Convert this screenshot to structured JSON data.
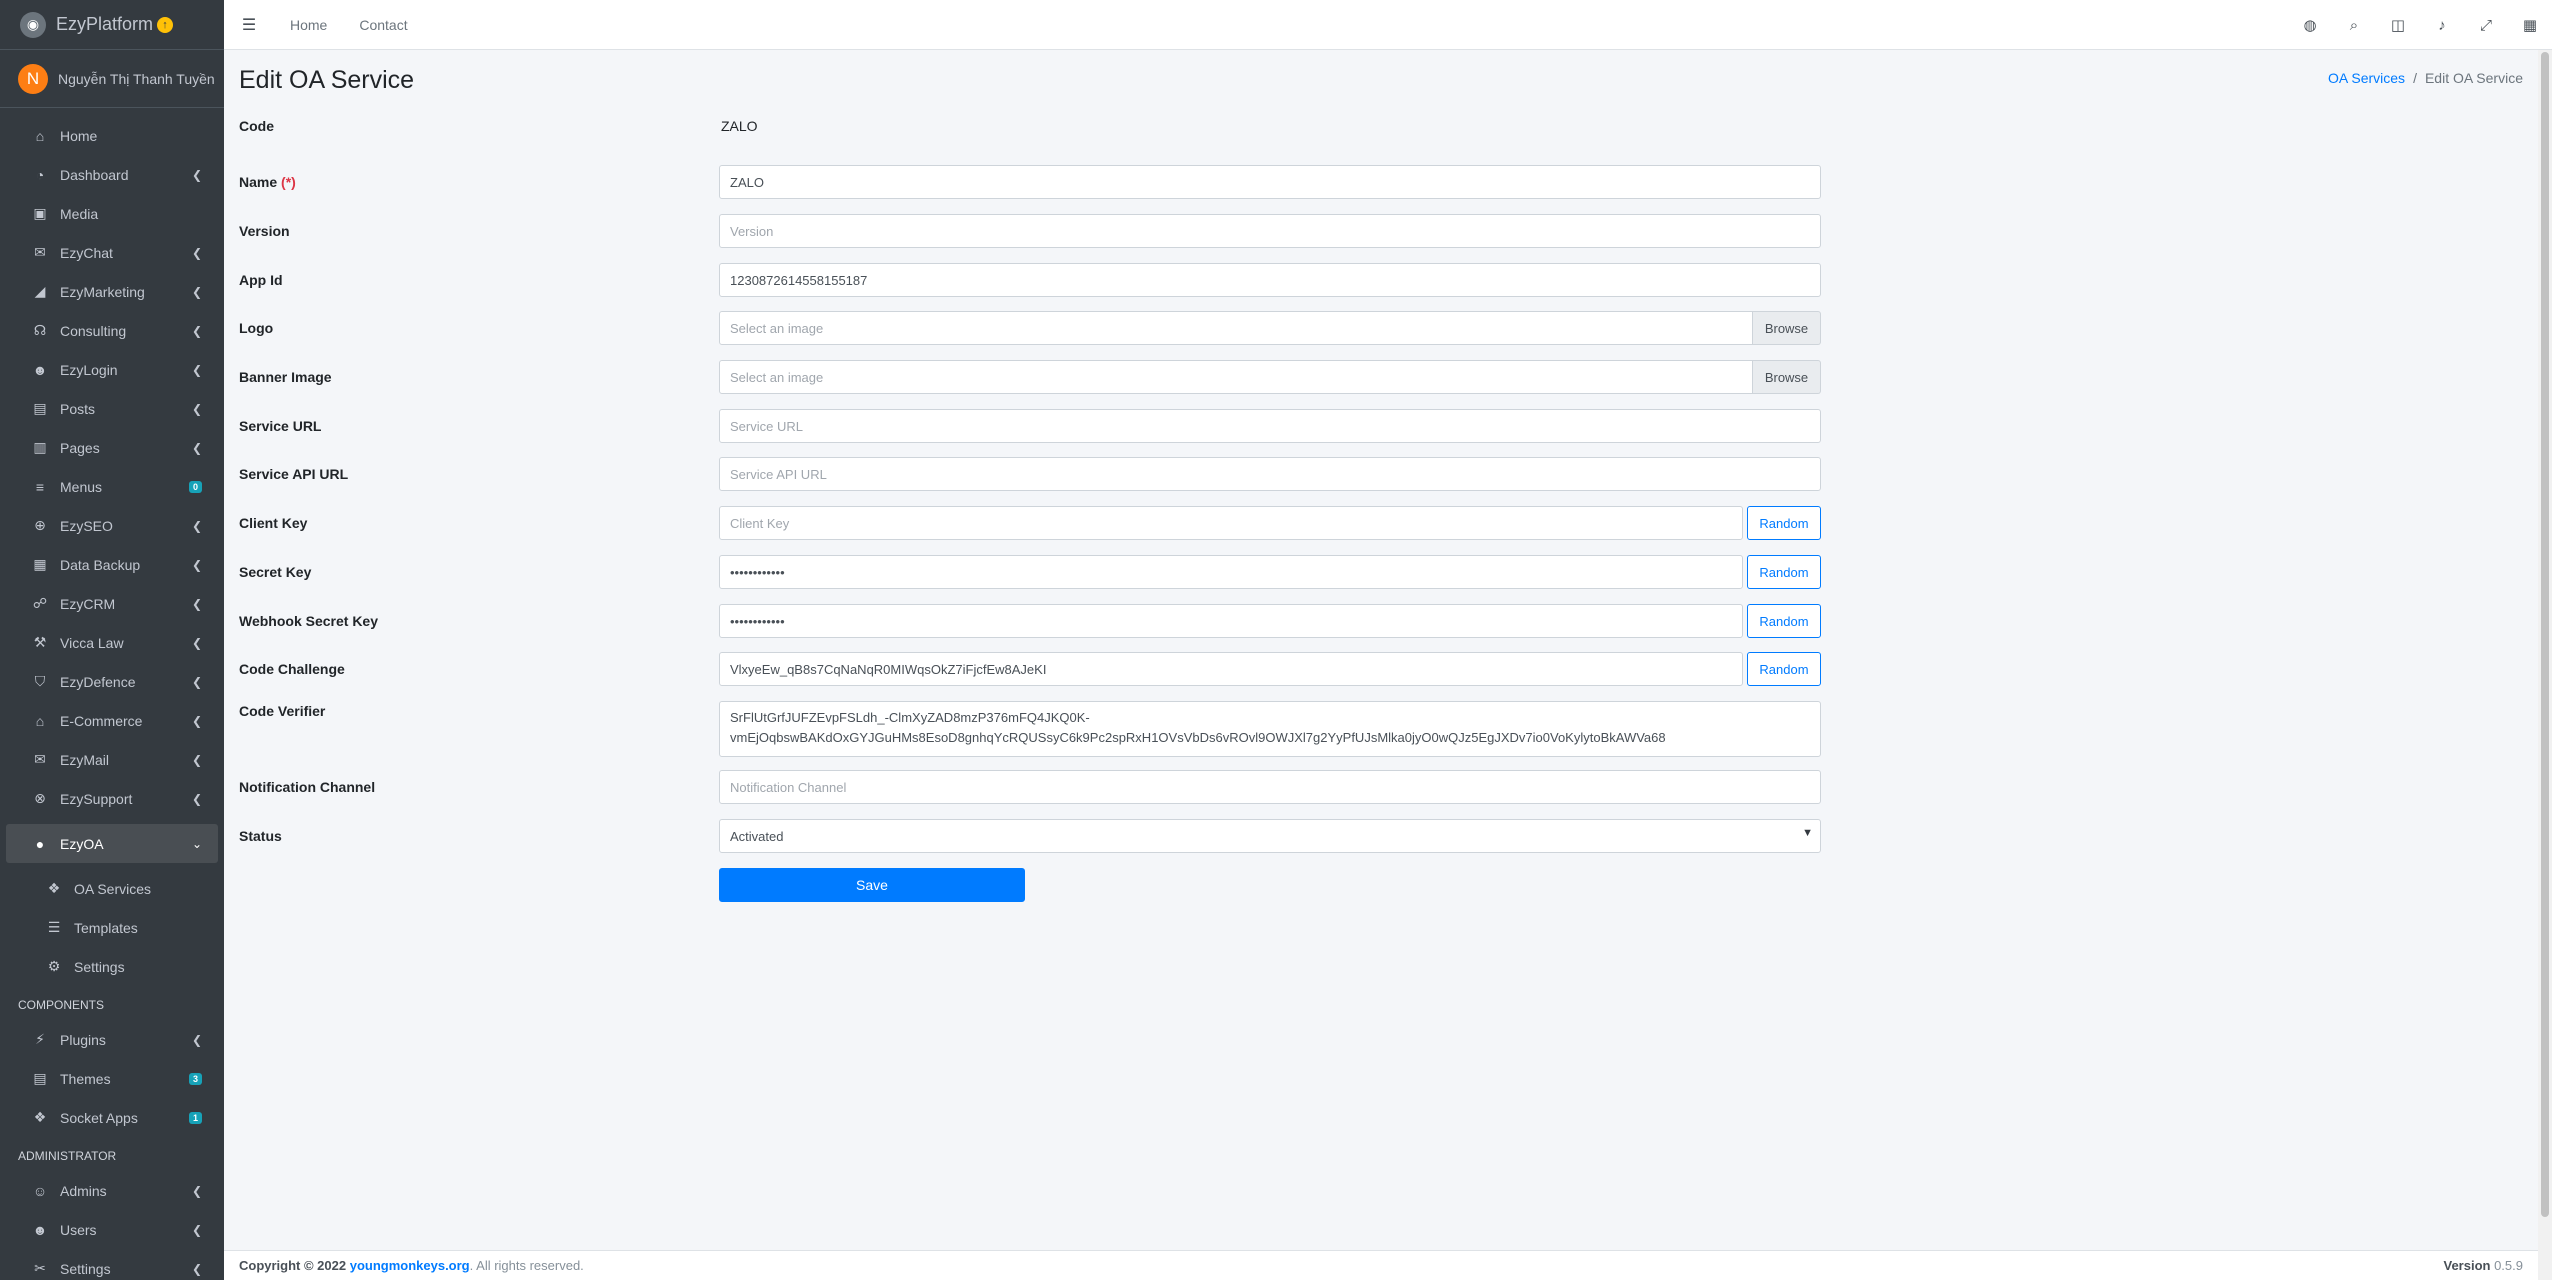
{
  "brand": {
    "name": "EzyPlatform",
    "badge": "↑"
  },
  "user": {
    "initial": "N",
    "name": "Nguyễn Thị Thanh Tuyền"
  },
  "sidebar": {
    "items": [
      {
        "label": "Home",
        "icon": "home-icon"
      },
      {
        "label": "Dashboard",
        "icon": "dashboard-icon",
        "arrow": "‹"
      },
      {
        "label": "Media",
        "icon": "image-icon"
      },
      {
        "label": "EzyChat",
        "icon": "chat-icon",
        "arrow": "‹"
      },
      {
        "label": "EzyMarketing",
        "icon": "megaphone-icon",
        "arrow": "‹"
      },
      {
        "label": "Consulting",
        "icon": "headset-icon",
        "arrow": "‹"
      },
      {
        "label": "EzyLogin",
        "icon": "user-lock-icon",
        "arrow": "‹"
      },
      {
        "label": "Posts",
        "icon": "posts-icon",
        "arrow": "‹"
      },
      {
        "label": "Pages",
        "icon": "pages-icon",
        "arrow": "‹"
      },
      {
        "label": "Menus",
        "icon": "menu-icon",
        "badge": "0"
      },
      {
        "label": "EzySEO",
        "icon": "search-plus-icon",
        "arrow": "‹"
      },
      {
        "label": "Data Backup",
        "icon": "database-icon",
        "arrow": "‹"
      },
      {
        "label": "EzyCRM",
        "icon": "handshake-icon",
        "arrow": "‹"
      },
      {
        "label": "Vicca Law",
        "icon": "gavel-icon",
        "arrow": "‹"
      },
      {
        "label": "EzyDefence",
        "icon": "shield-icon",
        "arrow": "‹"
      },
      {
        "label": "E-Commerce",
        "icon": "store-icon",
        "arrow": "‹"
      },
      {
        "label": "EzyMail",
        "icon": "mail-icon",
        "arrow": "‹"
      },
      {
        "label": "EzySupport",
        "icon": "support-icon",
        "arrow": "‹"
      },
      {
        "label": "EzyOA",
        "icon": "circle-icon",
        "arrow": "⌄"
      }
    ],
    "sub_items": [
      {
        "label": "OA Services",
        "icon": "cubes-icon"
      },
      {
        "label": "Templates",
        "icon": "list-icon"
      },
      {
        "label": "Settings",
        "icon": "cogs-icon"
      }
    ],
    "components_header": "COMPONENTS",
    "components": [
      {
        "label": "Plugins",
        "icon": "plug-icon",
        "arrow": "‹"
      },
      {
        "label": "Themes",
        "icon": "themes-icon",
        "badge": "3"
      },
      {
        "label": "Socket Apps",
        "icon": "socket-icon",
        "badge": "1"
      }
    ],
    "admin_header": "ADMINISTRATOR",
    "admin": [
      {
        "label": "Admins",
        "icon": "user-circle-icon",
        "arrow": "‹"
      },
      {
        "label": "Users",
        "icon": "users-icon",
        "arrow": "‹"
      },
      {
        "label": "Settings",
        "icon": "tools-icon",
        "arrow": "‹"
      }
    ]
  },
  "topbar": {
    "menu_icon": "☰",
    "links": [
      "Home",
      "Contact"
    ]
  },
  "page": {
    "title": "Edit OA Service",
    "breadcrumb": {
      "parent": "OA Services",
      "current": "Edit OA Service"
    }
  },
  "form": {
    "code": {
      "label": "Code",
      "value": "ZALO"
    },
    "name": {
      "label": "Name",
      "required": "(*)",
      "value": "ZALO"
    },
    "version": {
      "label": "Version",
      "placeholder": "Version"
    },
    "app_id": {
      "label": "App Id",
      "value": "1230872614558155187"
    },
    "logo": {
      "label": "Logo",
      "placeholder": "Select an image",
      "button": "Browse"
    },
    "banner": {
      "label": "Banner Image",
      "placeholder": "Select an image",
      "button": "Browse"
    },
    "service_url": {
      "label": "Service URL",
      "placeholder": "Service URL"
    },
    "service_api_url": {
      "label": "Service API URL",
      "placeholder": "Service API URL"
    },
    "client_key": {
      "label": "Client Key",
      "placeholder": "Client Key",
      "button": "Random"
    },
    "secret_key": {
      "label": "Secret Key",
      "value": "••••••••••••",
      "button": "Random"
    },
    "webhook_secret_key": {
      "label": "Webhook Secret Key",
      "value": "••••••••••••",
      "button": "Random"
    },
    "code_challenge": {
      "label": "Code Challenge",
      "value": "VlxyeEw_qB8s7CqNaNqR0MIWqsOkZ7iFjcfEw8AJeKI",
      "button": "Random"
    },
    "code_verifier": {
      "label": "Code Verifier",
      "value": "SrFlUtGrfJUFZEvpFSLdh_-ClmXyZAD8mzP376mFQ4JKQ0K-vmEjOqbswBAKdOxGYJGuHMs8EsoD8gnhqYcRQUSsyC6k9Pc2spRxH1OVsVbDs6vROvl9OWJXl7g2YyPfUJsMlka0jyO0wQJz5EgJXDv7io0VoKylytoBkAWVa68"
    },
    "notification_channel": {
      "label": "Notification Channel",
      "placeholder": "Notification Channel"
    },
    "status": {
      "label": "Status",
      "value": "Activated"
    },
    "save_label": "Save"
  },
  "footer": {
    "copyright_prefix": "Copyright © 2022 ",
    "link": "youngmonkeys.org",
    "suffix": ". All rights reserved.",
    "version_label": "Version",
    "version": "0.5.9"
  }
}
